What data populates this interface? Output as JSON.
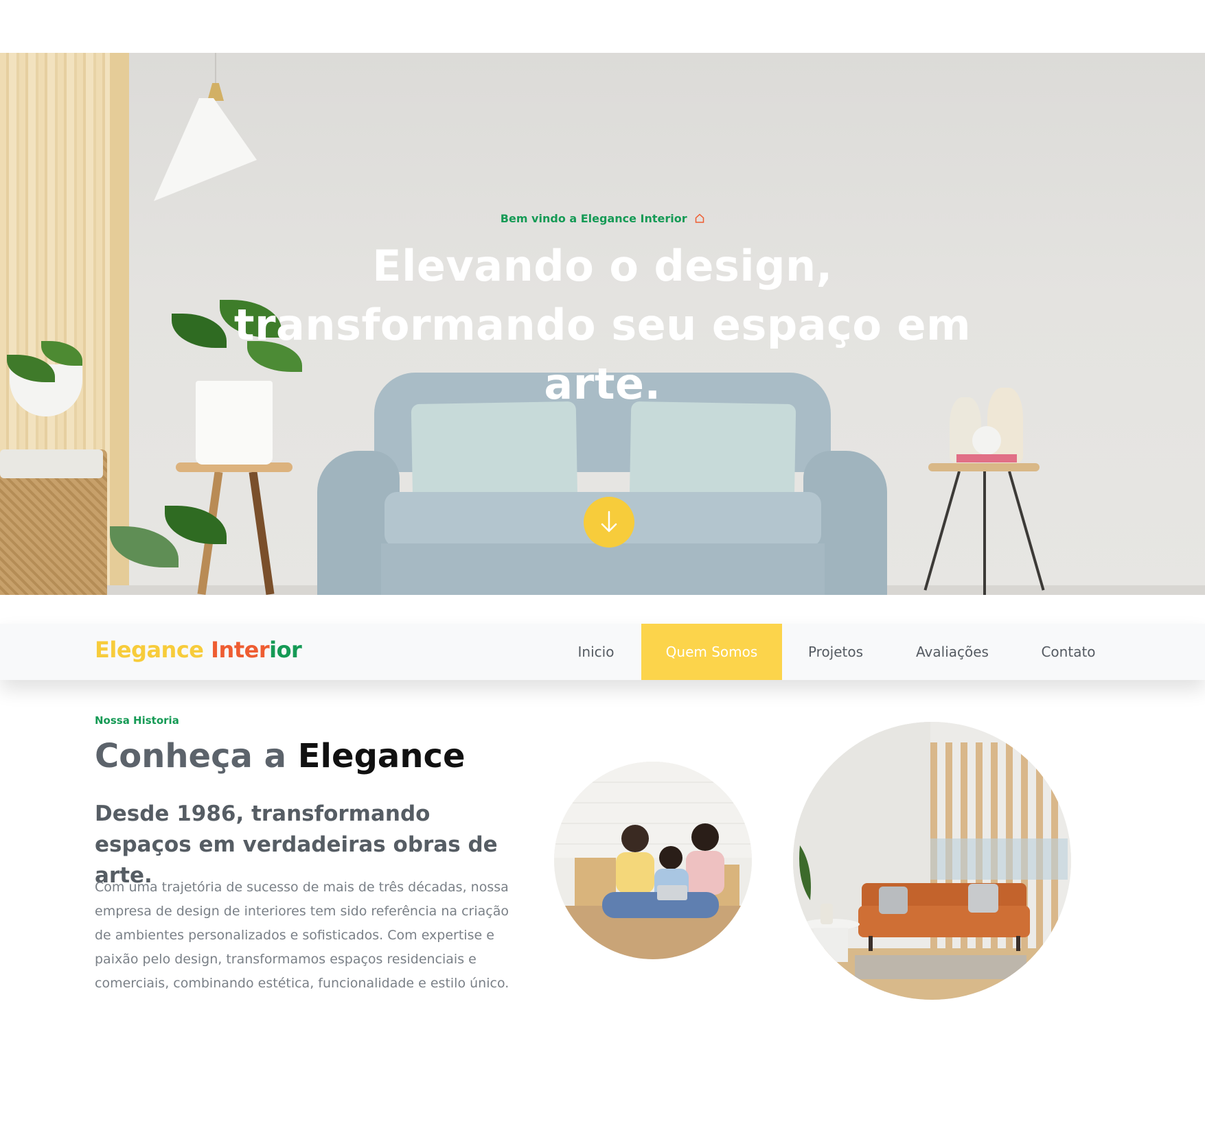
{
  "hero": {
    "eyebrow": "Bem vindo a Elegance Interior",
    "headline": "Elevando o design, transformando seu espaço em arte.",
    "scroll_icon": "arrow-down-icon",
    "accent_color": "#f7cc3b"
  },
  "nav": {
    "logo_part1": "Elegance",
    "logo_part2": "Inter",
    "logo_part3": "ior",
    "items": [
      {
        "label": "Inicio"
      },
      {
        "label": "Quem Somos",
        "active": true
      },
      {
        "label": "Projetos"
      },
      {
        "label": "Avaliações"
      },
      {
        "label": "Contato"
      }
    ],
    "active_color": "#fcd44b"
  },
  "about": {
    "kicker": "Nossa Historia",
    "title_part1": "Conheça a",
    "title_part2": "Elegance",
    "subtitle": "Desde 1986, transformando espaços em verdadeiras obras de arte.",
    "body": "Com uma trajetória de sucesso de mais de três décadas, nossa empresa de design de interiores tem sido referência na criação de ambientes personalizados e sofisticados. Com expertise e paixão pelo design, transformamos espaços residenciais e comerciais, combinando estética, funcionalidade e estilo único."
  },
  "colors": {
    "brand_yellow": "#f7cc3b",
    "brand_orange": "#ee5d32",
    "brand_green": "#159a55"
  }
}
